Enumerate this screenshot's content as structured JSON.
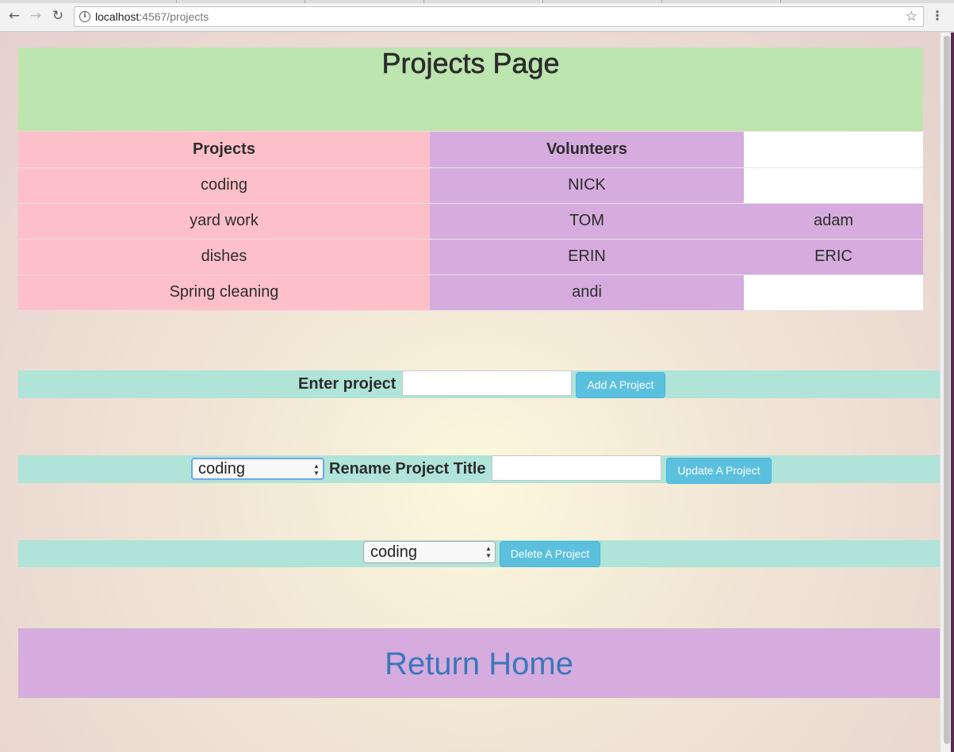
{
  "browser": {
    "url_host": "localhost",
    "url_path": ":4567/projects",
    "back_icon": "arrow-left-icon",
    "forward_icon": "arrow-right-icon",
    "reload_icon": "reload-icon",
    "info_icon": "info-icon",
    "star_icon": "star-icon",
    "menu_icon": "menu-dots-icon"
  },
  "page": {
    "title": "Projects Page"
  },
  "table": {
    "headers": [
      "Projects",
      "Volunteers",
      ""
    ],
    "rows": [
      {
        "project": "coding",
        "volunteer": "NICK",
        "extra": ""
      },
      {
        "project": "yard work",
        "volunteer": "TOM",
        "extra": "adam"
      },
      {
        "project": "dishes",
        "volunteer": "ERIN",
        "extra": "ERIC"
      },
      {
        "project": "Spring cleaning",
        "volunteer": "andi",
        "extra": ""
      }
    ]
  },
  "add_form": {
    "label": "Enter project",
    "input_value": "",
    "button_label": "Add A Project"
  },
  "update_form": {
    "selected": "coding",
    "label": "Rename Project Title",
    "input_value": "",
    "button_label": "Update A Project"
  },
  "delete_form": {
    "selected": "coding",
    "button_label": "Delete A Project"
  },
  "footer": {
    "link_label": "Return Home"
  },
  "colors": {
    "header_bg": "#bde5af",
    "projects_col": "#fec0c8",
    "volunteers_col": "#d6acde",
    "form_band": "#b0e4d8",
    "button": "#5bc0de",
    "link": "#3a77ba"
  }
}
